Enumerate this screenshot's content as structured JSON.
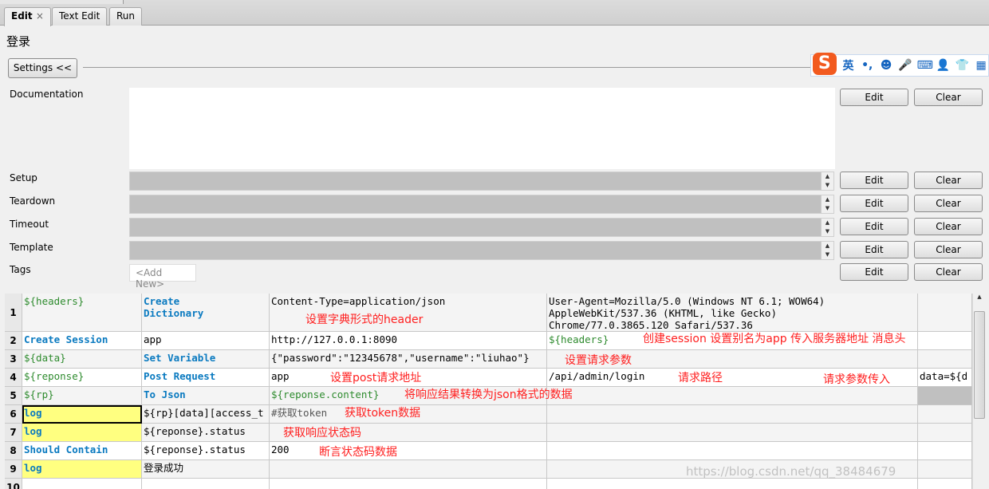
{
  "tabs": [
    {
      "label": "Edit",
      "active": true
    },
    {
      "label": "Text Edit"
    },
    {
      "label": "Run"
    }
  ],
  "title": "登录",
  "settings_button": "Settings <<",
  "ime_toolbar": {
    "items": [
      "S",
      "英",
      "•,",
      "☻",
      "🎤",
      "⌨",
      "👤",
      "👕",
      "▦"
    ]
  },
  "fields": [
    {
      "label": "Documentation",
      "edit": "Edit",
      "clear": "Clear"
    },
    {
      "label": "Setup",
      "edit": "Edit",
      "clear": "Clear"
    },
    {
      "label": "Teardown",
      "edit": "Edit",
      "clear": "Clear"
    },
    {
      "label": "Timeout",
      "edit": "Edit",
      "clear": "Clear"
    },
    {
      "label": "Template",
      "edit": "Edit",
      "clear": "Clear"
    },
    {
      "label": "Tags",
      "edit": "Edit",
      "clear": "Clear",
      "add_new": "<Add New>"
    }
  ],
  "rows": [
    {
      "num": "1",
      "cells": [
        {
          "t": "${headers}",
          "s": "var"
        },
        {
          "t": "Create\nDictionary",
          "s": "kw"
        },
        {
          "t": "Content-Type=application/json"
        },
        {
          "t": "User-Agent=Mozilla/5.0 (Windows NT 6.1; WOW64)\nAppleWebKit/537.36 (KHTML, like Gecko)\nChrome/77.0.3865.120 Safari/537.36"
        },
        {
          "t": ""
        }
      ]
    },
    {
      "num": "2",
      "cells": [
        {
          "t": "Create Session",
          "s": "kw"
        },
        {
          "t": "app"
        },
        {
          "t": "http://127.0.0.1:8090"
        },
        {
          "t": "${headers}",
          "s": "var"
        },
        {
          "t": ""
        }
      ]
    },
    {
      "num": "3",
      "cells": [
        {
          "t": "${data}",
          "s": "var"
        },
        {
          "t": "Set Variable",
          "s": "kw"
        },
        {
          "t": "{\"password\":\"12345678\",\"username\":\"liuhao\"}"
        },
        {
          "t": ""
        },
        {
          "t": ""
        }
      ]
    },
    {
      "num": "4",
      "cells": [
        {
          "t": "${reponse}",
          "s": "var"
        },
        {
          "t": "Post Request",
          "s": "kw"
        },
        {
          "t": "app"
        },
        {
          "t": "/api/admin/login"
        },
        {
          "t": "data=${d"
        }
      ]
    },
    {
      "num": "5",
      "cells": [
        {
          "t": "${rp}",
          "s": "var"
        },
        {
          "t": "To Json",
          "s": "kw"
        },
        {
          "t": "${reponse.content}",
          "s": "var"
        },
        {
          "t": ""
        },
        {
          "t": "",
          "s": "grey"
        }
      ]
    },
    {
      "num": "6",
      "cells": [
        {
          "t": "log",
          "s": "kw yellow selected"
        },
        {
          "t": "${rp}[data][access_t"
        },
        {
          "t": "#获取token",
          "s": "comment"
        },
        {
          "t": ""
        },
        {
          "t": ""
        }
      ]
    },
    {
      "num": "7",
      "cells": [
        {
          "t": "log",
          "s": "kw yellow"
        },
        {
          "t": "${reponse}.status"
        },
        {
          "t": ""
        },
        {
          "t": ""
        },
        {
          "t": ""
        }
      ]
    },
    {
      "num": "8",
      "cells": [
        {
          "t": "Should Contain",
          "s": "kw"
        },
        {
          "t": "${reponse}.status"
        },
        {
          "t": "200"
        },
        {
          "t": ""
        },
        {
          "t": ""
        }
      ]
    },
    {
      "num": "9",
      "cells": [
        {
          "t": "log",
          "s": "kw yellow"
        },
        {
          "t": "登录成功"
        },
        {
          "t": ""
        },
        {
          "t": ""
        },
        {
          "t": ""
        }
      ]
    },
    {
      "num": "10",
      "cells": [
        {
          "t": ""
        },
        {
          "t": ""
        },
        {
          "t": ""
        },
        {
          "t": ""
        },
        {
          "t": ""
        }
      ]
    }
  ],
  "annotations": [
    "设置字典形式的header",
    "创建session 设置别名为app  传入服务器地址 消息头",
    "设置请求参数",
    "设置post请求地址",
    "请求路径",
    "请求参数传入",
    "将响应结果转换为json格式的数据",
    "获取token数据",
    "获取响应状态码",
    "断言状态码数据"
  ],
  "watermark": "https://blog.csdn.net/qq_38484679",
  "colors": {
    "keyword": "#0a7ac0",
    "variable": "#2e8b2e",
    "annotation": "#ff2020",
    "highlight": "#ffff80"
  }
}
